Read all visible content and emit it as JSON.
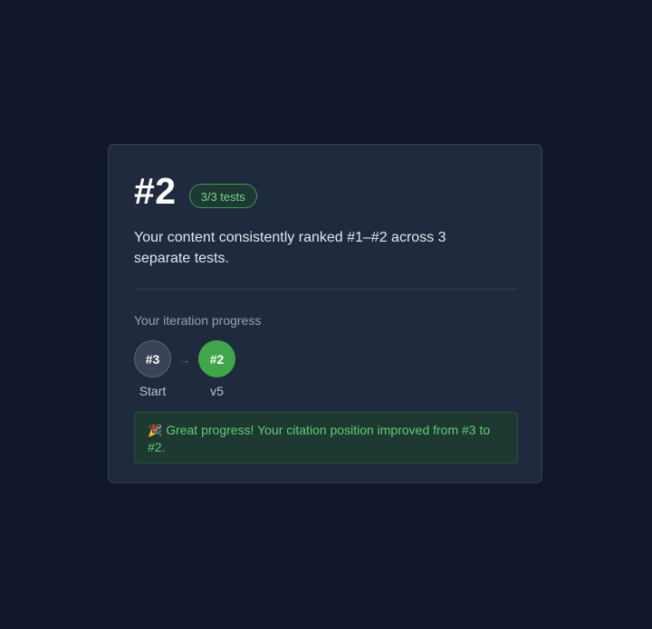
{
  "result": {
    "rank": "#2",
    "badge": "3/3 tests",
    "description": "Your content consistently ranked #1–#2 across 3 separate tests."
  },
  "progress": {
    "section_label": "Your iteration progress",
    "arrow": "→",
    "steps": [
      {
        "rank": "#3",
        "label": "Start"
      },
      {
        "rank": "#2",
        "label": "v5"
      }
    ]
  },
  "alert": {
    "icon": "party-popper-icon",
    "emoji": "🎉",
    "message": "Great progress! Your citation position improved from #3 to #2."
  },
  "colors": {
    "background": "#11172a",
    "card": "#1f2a3f",
    "success": "#3fa64a",
    "success_text": "#5fce75"
  }
}
